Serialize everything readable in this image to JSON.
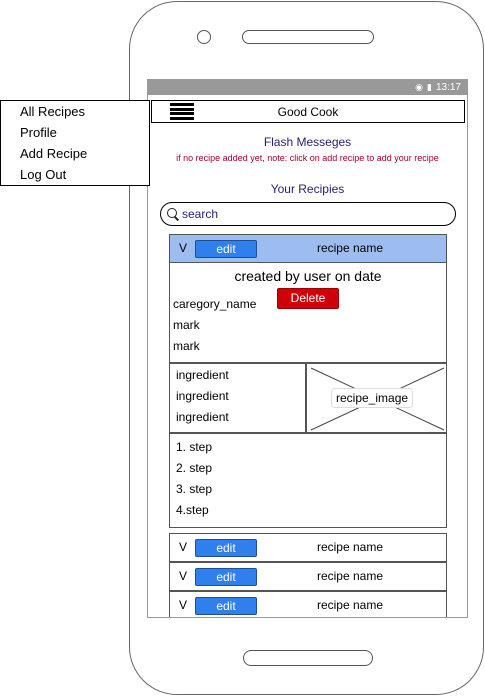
{
  "app": {
    "title": "Good Cook"
  },
  "menu": {
    "items": [
      "All Recipes",
      "Profile",
      "Add Recipe",
      "Log Out"
    ]
  },
  "statusbar": {
    "time": "13:17"
  },
  "flash": {
    "title": "Flash Messeges",
    "note": "if no recipe added yet, note: click on add recipe to add your recipe"
  },
  "section": {
    "title": "Your Recipies"
  },
  "search": {
    "placeholder": "search"
  },
  "recipes": [
    {
      "toggle": "V",
      "edit_label": "edit",
      "name": "recipe name"
    },
    {
      "toggle": "V",
      "edit_label": "edit",
      "name": "recipe name"
    },
    {
      "toggle": "V",
      "edit_label": "edit",
      "name": "recipe name"
    },
    {
      "toggle": "V",
      "edit_label": "edit",
      "name": "recipe name"
    }
  ],
  "detail": {
    "created": "created by  user on date",
    "category": "caregory_name",
    "delete_label": "Delete",
    "marks": [
      "mark",
      "mark"
    ],
    "ingredients": [
      "ingredient",
      "ingredient",
      "ingredient"
    ],
    "image_label": "recipe_image",
    "steps": [
      "1. step",
      "2. step",
      "3. step",
      "4.step"
    ]
  },
  "colors": {
    "accent": "#2f80ed",
    "active_row": "#9dbcf0",
    "delete": "#d0000a",
    "title_text": "#2a1a6e",
    "note_text": "#a00030"
  }
}
